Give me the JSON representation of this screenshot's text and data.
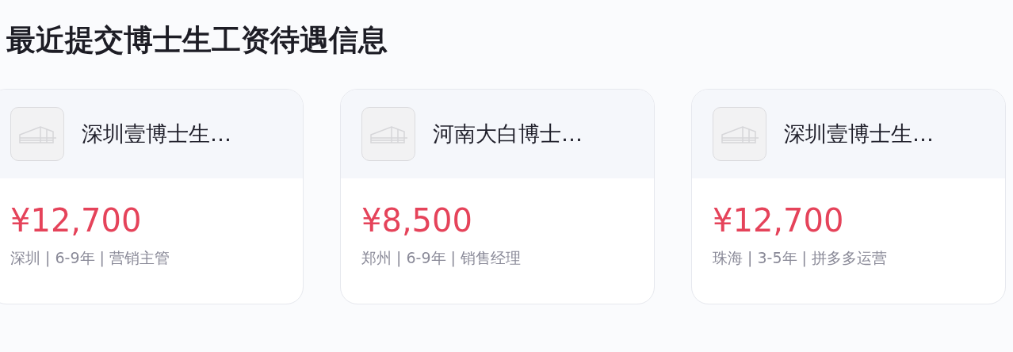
{
  "title": "最近提交博士生工资待遇信息",
  "cards": [
    {
      "company": "深圳壹博士生…",
      "salary": "¥12,700",
      "meta": "深圳 | 6-9年 | 营销主管"
    },
    {
      "company": "河南大白博士…",
      "salary": "¥8,500",
      "meta": "郑州 | 6-9年 | 销售经理"
    },
    {
      "company": "深圳壹博士生…",
      "salary": "¥12,700",
      "meta": "珠海 | 3-5年 | 拼多多运营"
    }
  ]
}
